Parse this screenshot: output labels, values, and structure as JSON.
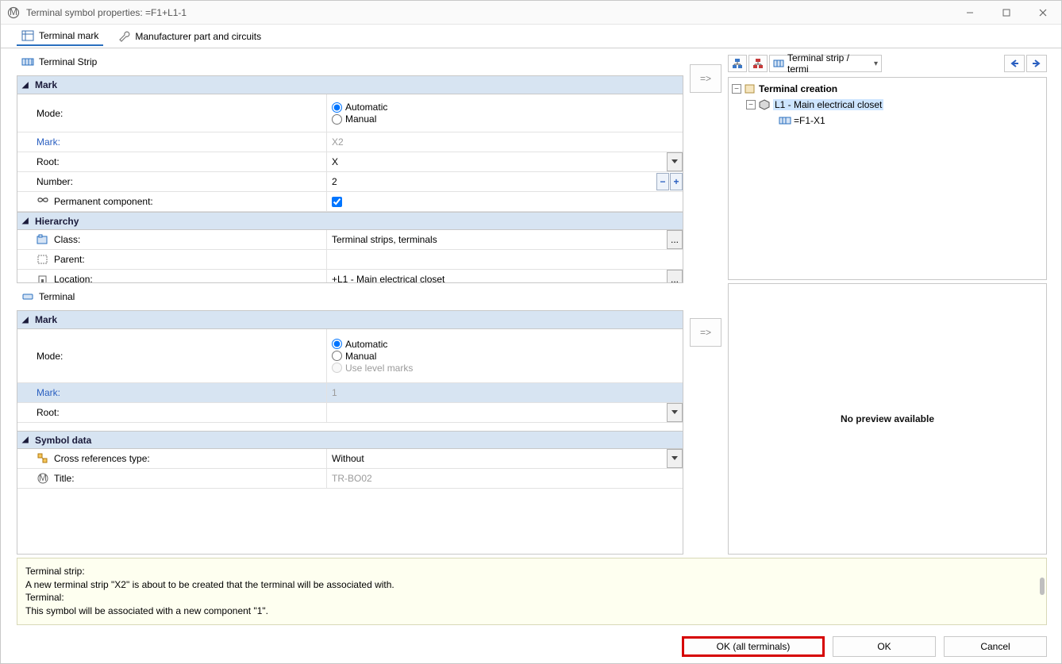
{
  "window": {
    "title": "Terminal symbol properties: =F1+L1-1"
  },
  "tabs": {
    "terminal_mark": "Terminal mark",
    "manufacturer": "Manufacturer part and circuits"
  },
  "section1_title": "Terminal Strip",
  "section2_title": "Terminal",
  "groups": {
    "mark": "Mark",
    "hierarchy": "Hierarchy",
    "symbol_data": "Symbol data"
  },
  "labels": {
    "mode": "Mode:",
    "mark": "Mark:",
    "root": "Root:",
    "number": "Number:",
    "permanent": "Permanent component:",
    "class": "Class:",
    "parent": "Parent:",
    "location": "Location:",
    "cross_ref": "Cross references type:",
    "title": "Title:"
  },
  "radio": {
    "automatic": "Automatic",
    "manual": "Manual",
    "use_level": "Use level marks"
  },
  "values": {
    "ts_mark": "X2",
    "ts_root": "X",
    "ts_number": "2",
    "ts_perm_checked": true,
    "class": "Terminal strips, terminals",
    "parent": "",
    "location": "+L1 - Main electrical closet",
    "t_mark": "1",
    "t_root": "",
    "cross_ref": "Without",
    "title": "TR-BO02"
  },
  "tree": {
    "select_label": "Terminal strip / termi",
    "root": "Terminal creation",
    "child": "L1 - Main electrical closet",
    "leaf": "=F1-X1"
  },
  "preview": {
    "text": "No preview available"
  },
  "info": {
    "l1": "Terminal strip:",
    "l2": "A new terminal strip \"X2\" is about to be created that the terminal will be associated with.",
    "l3": "Terminal:",
    "l4": "This symbol will be associated with a new component \"1\"."
  },
  "footer": {
    "ok_all": "OK (all terminals)",
    "ok": "OK",
    "cancel": "Cancel"
  },
  "arrow": "=>"
}
